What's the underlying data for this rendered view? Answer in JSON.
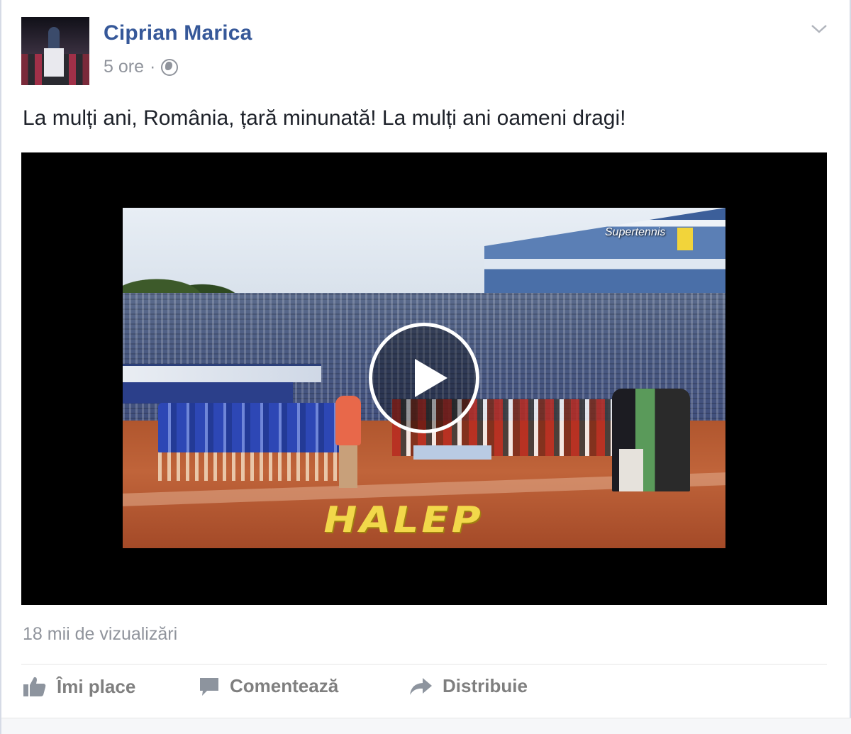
{
  "post": {
    "author": "Ciprian Marica",
    "time": "5 ore",
    "separator": "·",
    "privacy_icon": "globe-icon",
    "text": "La mulți ani, România, țară minunată! La mulți ani oameni dragi!",
    "menu_icon": "chevron-down-icon"
  },
  "video": {
    "overlay_text": "HALEP",
    "channel_logo": "Supertennis",
    "play_icon": "play-icon"
  },
  "stats": {
    "views": "18 mii de vizualizări"
  },
  "actions": {
    "like_label": "Îmi place",
    "comment_label": "Comentează",
    "share_label": "Distribuie"
  },
  "colors": {
    "author_link": "#365899",
    "meta_gray": "#90949c",
    "action_gray": "#7f7f7f"
  }
}
